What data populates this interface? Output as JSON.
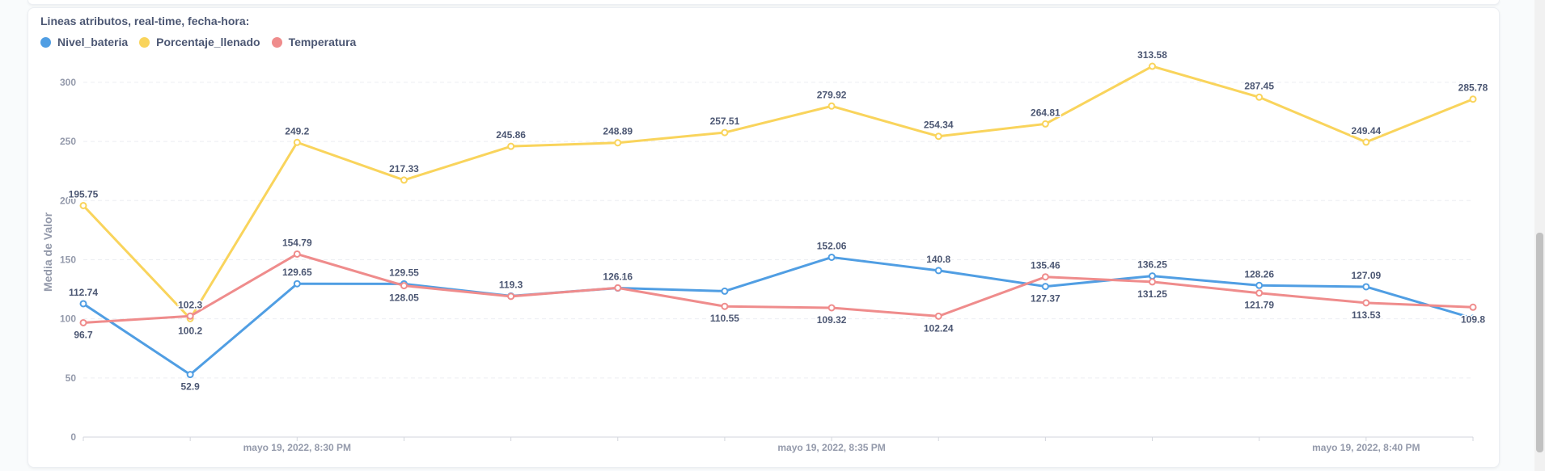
{
  "card": {
    "title": "Lineas atributos, real-time, fecha-hora:"
  },
  "colors": {
    "Nivel_bateria": "#509ee3",
    "Porcentaje_llenado": "#f9d45c",
    "Temperatura": "#ef8c8c"
  },
  "chart_data": {
    "type": "line",
    "ylabel": "Media de Valor",
    "xlabel": "",
    "ylim": [
      0,
      330
    ],
    "yticks": [
      0,
      50,
      100,
      150,
      200,
      250,
      300
    ],
    "xtick_labels": [
      {
        "index": 2,
        "label": "mayo 19, 2022, 8:30 PM"
      },
      {
        "index": 7,
        "label": "mayo 19, 2022, 8:35 PM"
      },
      {
        "index": 12,
        "label": "mayo 19, 2022, 8:40 PM"
      }
    ],
    "x_count": 14,
    "legend_position": "top-left",
    "grid": true,
    "series": [
      {
        "name": "Nivel_bateria",
        "values": [
          112.74,
          52.9,
          129.65,
          129.55,
          119.3,
          126.05,
          123.4,
          152.06,
          140.8,
          127.37,
          136.25,
          128.26,
          127.09,
          100.5
        ],
        "labels": [
          "112.74",
          "52.9",
          "129.65",
          "129.55",
          "119.3",
          "126.05",
          "",
          "152.06",
          "140.8",
          "127.37",
          "136.25",
          "128.26",
          "127.09",
          ""
        ]
      },
      {
        "name": "Porcentaje_llenado",
        "values": [
          195.75,
          100.2,
          249.2,
          217.33,
          245.86,
          248.89,
          257.51,
          279.92,
          254.34,
          264.81,
          313.58,
          287.45,
          249.44,
          285.78
        ],
        "labels": [
          "195.75",
          "100.2",
          "249.2",
          "217.33",
          "245.86",
          "248.89",
          "257.51",
          "279.92",
          "254.34",
          "264.81",
          "313.58",
          "287.45",
          "249.44",
          "285.78"
        ]
      },
      {
        "name": "Temperatura",
        "values": [
          96.7,
          102.3,
          154.79,
          128.05,
          119.0,
          126.16,
          110.55,
          109.32,
          102.24,
          135.46,
          131.25,
          121.79,
          113.53,
          109.8
        ],
        "labels": [
          "96.7",
          "102.3",
          "154.79",
          "128.05",
          "",
          "126.16",
          "110.55",
          "109.32",
          "102.24",
          "135.46",
          "131.25",
          "121.79",
          "113.53",
          "109.8"
        ]
      }
    ]
  }
}
